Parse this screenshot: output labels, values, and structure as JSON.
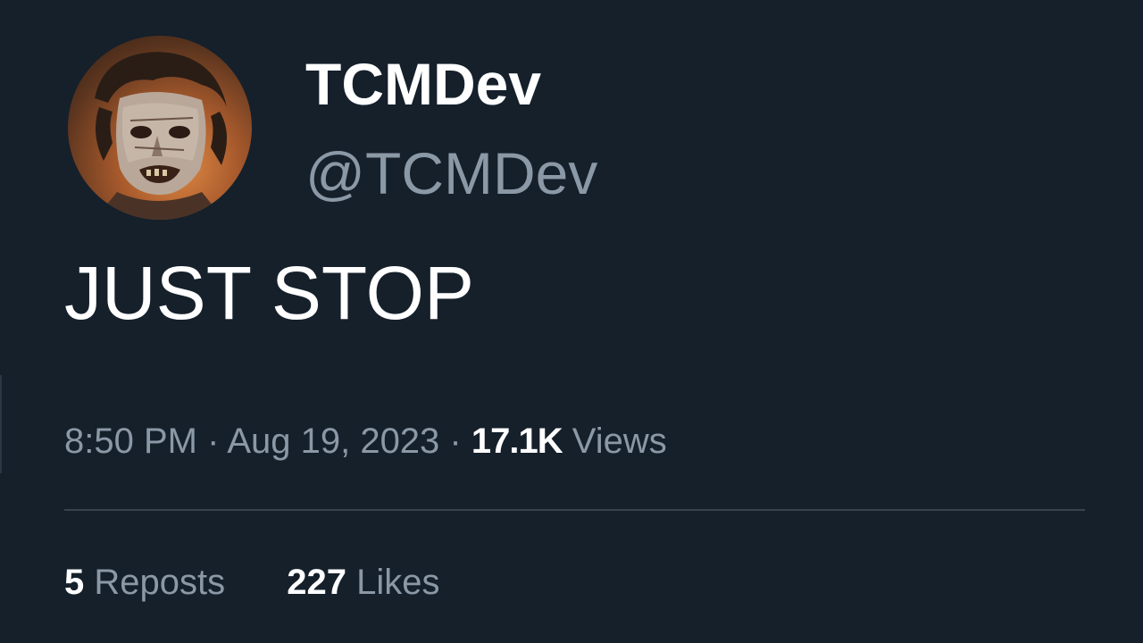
{
  "author": {
    "display_name": "TCMDev",
    "handle": "@TCMDev"
  },
  "tweet": {
    "text": "JUST STOP"
  },
  "meta": {
    "time": "8:50 PM",
    "separator_1": " · ",
    "date": "Aug 19, 2023",
    "separator_2": " · ",
    "views_count": "17.1K",
    "views_label": "Views"
  },
  "stats": {
    "reposts_count": "5",
    "reposts_label": "Reposts",
    "likes_count": "227",
    "likes_label": "Likes"
  },
  "colors": {
    "background": "#15202b",
    "primary_text": "#ffffff",
    "secondary_text": "#8b98a5",
    "divider": "#38444d"
  }
}
